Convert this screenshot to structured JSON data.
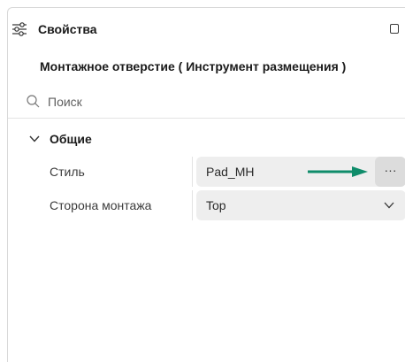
{
  "header": {
    "title": "Свойства",
    "icon": "sliders-icon",
    "window_button_icon": "maximize-icon"
  },
  "subtitle": "Монтажное отверстие ( Инструмент размещения )",
  "search": {
    "placeholder": "Поиск",
    "icon": "search-icon"
  },
  "group": {
    "label": "Общие",
    "expanded": true
  },
  "properties": [
    {
      "label": "Стиль",
      "value": "Pad_MH",
      "more_button": "···"
    },
    {
      "label": "Сторона монтажа",
      "value": "Top"
    }
  ],
  "colors": {
    "arrow": "#0f8c6a",
    "field_bg": "#eeeeee",
    "more_bg": "#dcdcdc"
  }
}
